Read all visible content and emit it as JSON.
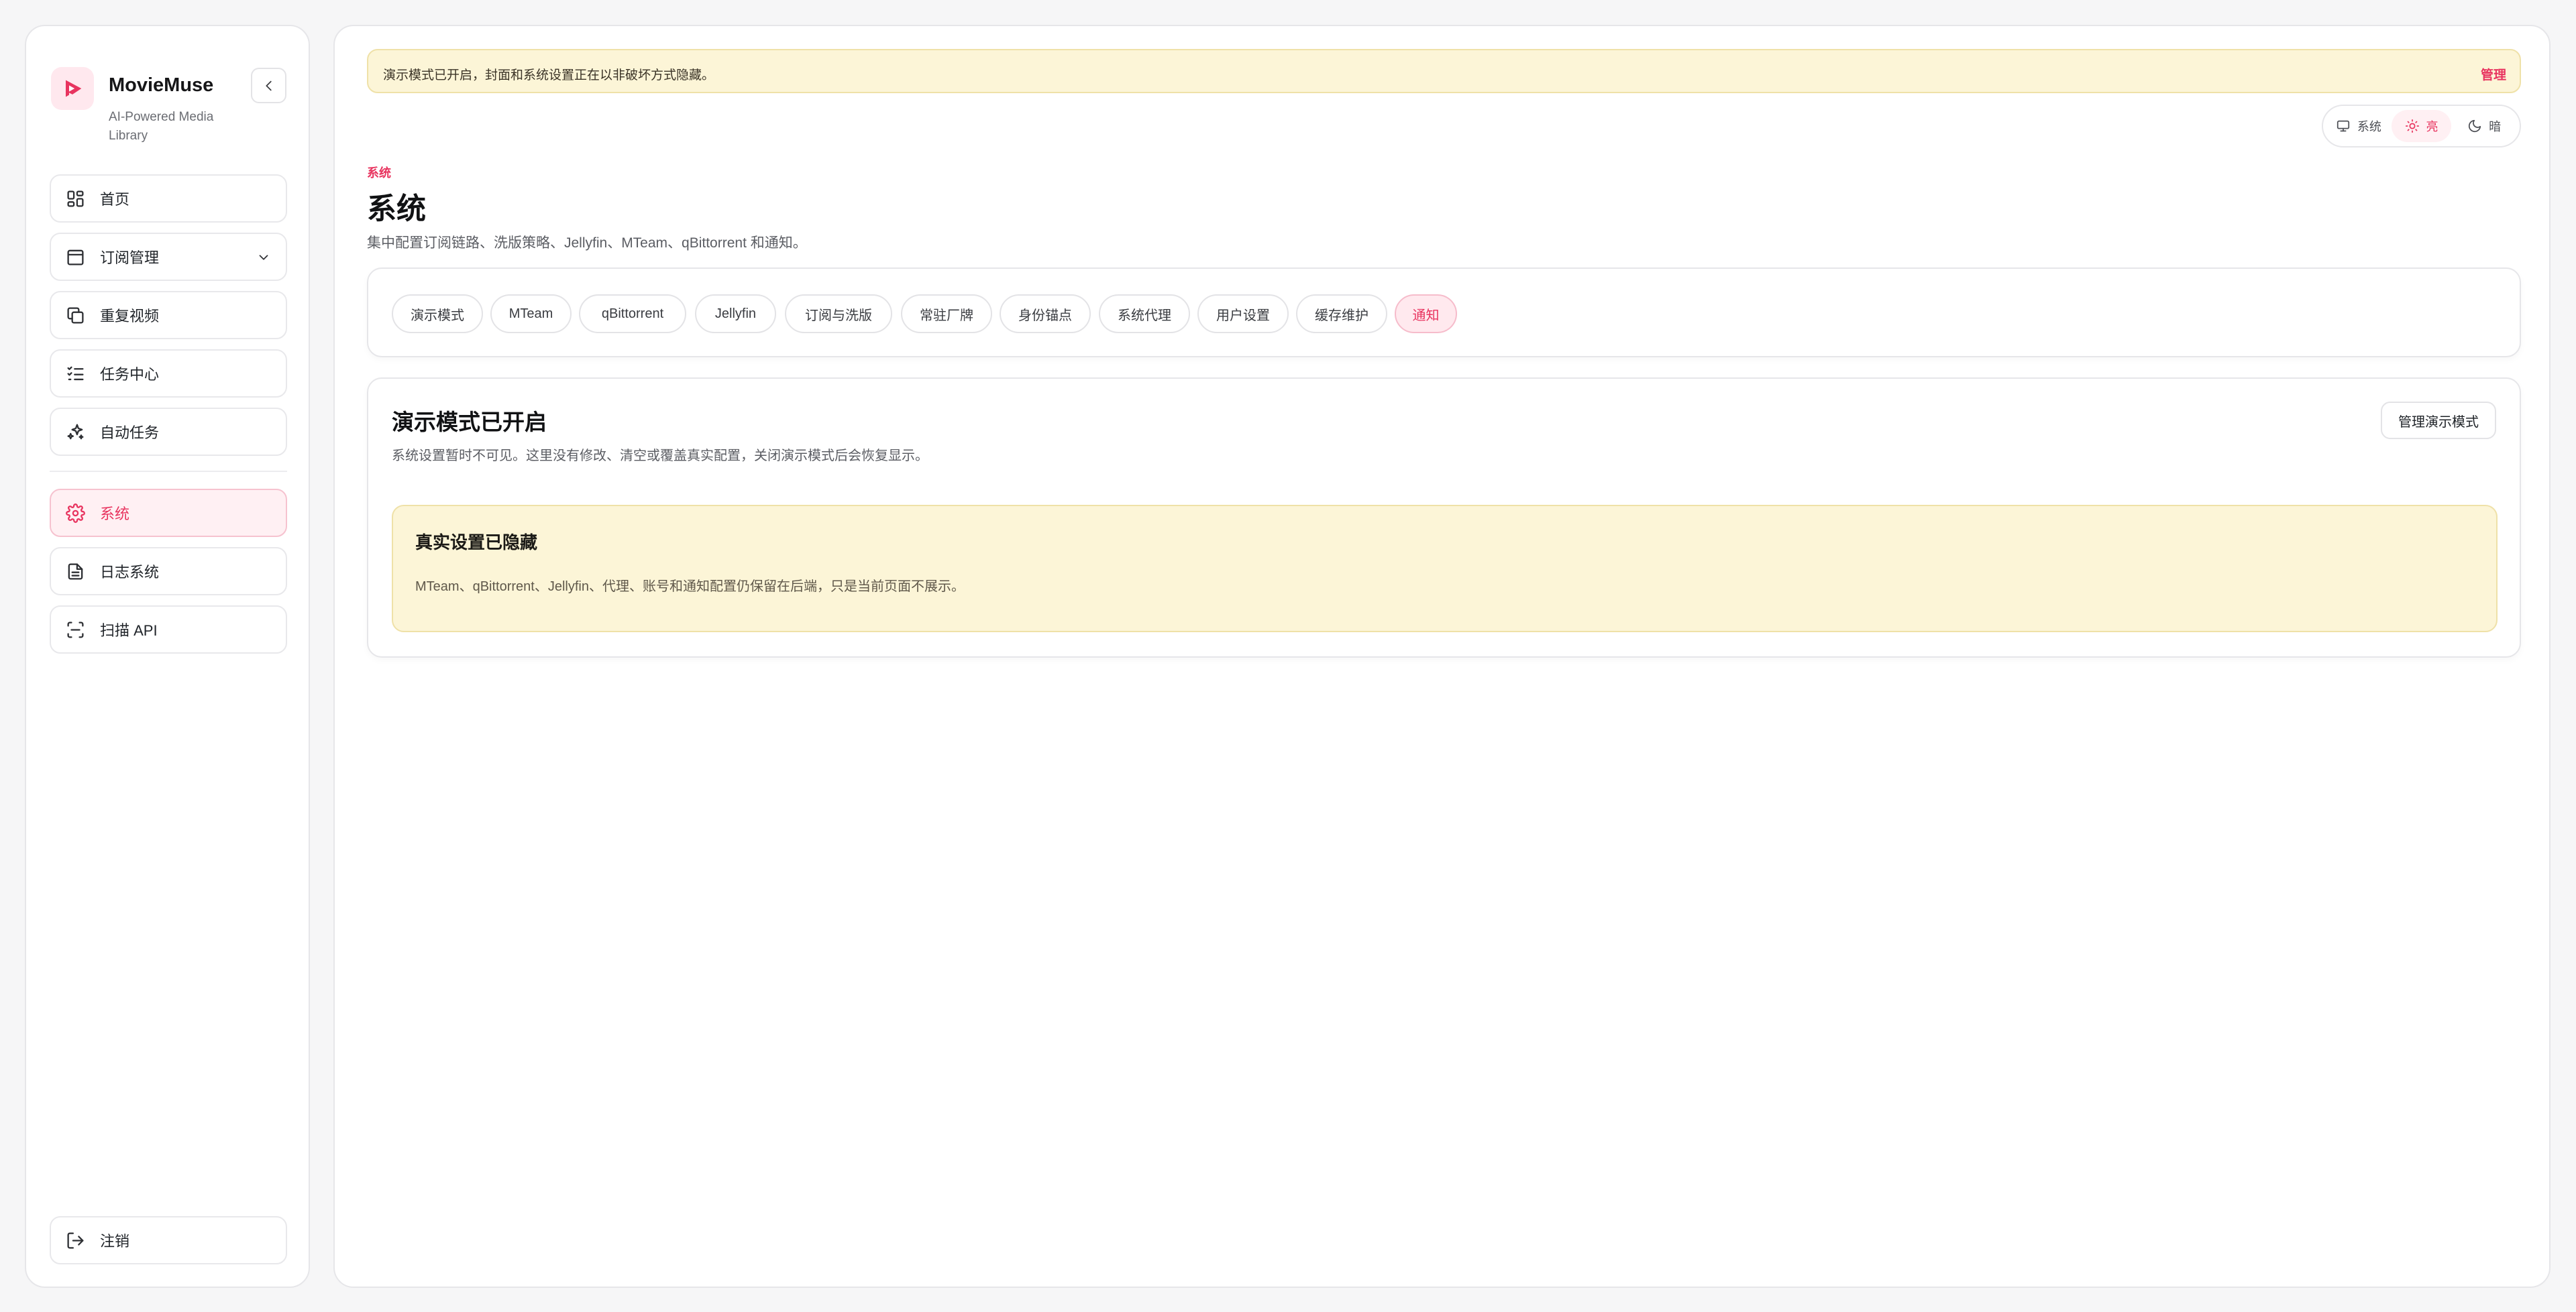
{
  "brand": {
    "name": "MovieMuse",
    "tagline": "AI-Powered Media Library"
  },
  "sidebar": {
    "items": [
      {
        "label": "首页",
        "icon": "dashboard-icon"
      },
      {
        "label": "订阅管理",
        "icon": "calendar-icon",
        "expandable": true
      },
      {
        "label": "重复视频",
        "icon": "copy-icon"
      },
      {
        "label": "任务中心",
        "icon": "list-check-icon"
      },
      {
        "label": "自动任务",
        "icon": "sparkles-icon"
      },
      {
        "label": "系统",
        "icon": "gear-icon",
        "active": true
      },
      {
        "label": "日志系统",
        "icon": "document-icon"
      },
      {
        "label": "扫描 API",
        "icon": "scan-icon"
      }
    ],
    "logout": {
      "label": "注销",
      "icon": "logout-icon"
    }
  },
  "banner": {
    "message": "演示模式已开启，封面和系统设置正在以非破坏方式隐藏。",
    "action": "管理"
  },
  "theme": {
    "options": [
      {
        "label": "系统",
        "icon": "monitor-icon"
      },
      {
        "label": "亮",
        "icon": "sun-icon",
        "active": true
      },
      {
        "label": "暗",
        "icon": "moon-icon"
      }
    ]
  },
  "page": {
    "eyebrow": "系统",
    "title": "系统",
    "description": "集中配置订阅链路、洗版策略、Jellyfin、MTeam、qBittorrent 和通知。"
  },
  "tabs": [
    {
      "label": "演示模式"
    },
    {
      "label": "MTeam"
    },
    {
      "label": "qBittorrent"
    },
    {
      "label": "Jellyfin"
    },
    {
      "label": "订阅与洗版"
    },
    {
      "label": "常驻厂牌"
    },
    {
      "label": "身份锚点"
    },
    {
      "label": "系统代理"
    },
    {
      "label": "用户设置"
    },
    {
      "label": "缓存维护"
    },
    {
      "label": "通知",
      "active": true
    }
  ],
  "demo": {
    "title": "演示模式已开启",
    "description": "系统设置暂时不可见。这里没有修改、清空或覆盖真实配置，关闭演示模式后会恢复显示。",
    "manage_button": "管理演示模式",
    "notice_title": "真实设置已隐藏",
    "notice_body": "MTeam、qBittorrent、Jellyfin、代理、账号和通知配置仍保留在后端，只是当前页面不展示。"
  },
  "colors": {
    "accent": "#e8345f",
    "warning_bg": "#fcf5d7"
  }
}
